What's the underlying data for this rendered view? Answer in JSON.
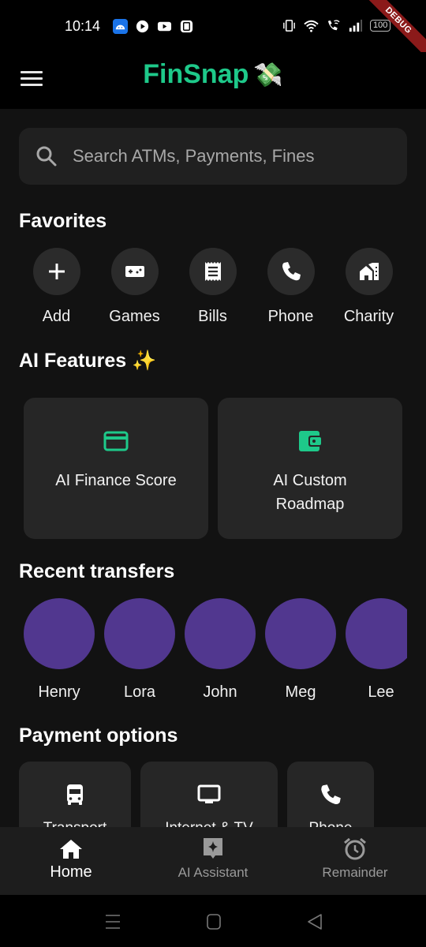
{
  "status_bar": {
    "time": "10:14",
    "left_icons": [
      "android-icon",
      "play-icon",
      "youtube-icon",
      "screenshot-icon"
    ],
    "right_icons": [
      "vibrate-icon",
      "wifi-icon",
      "wifi-calling-icon",
      "signal-icon"
    ],
    "battery": "100",
    "debug_label": "DEBUG"
  },
  "app_bar": {
    "title": "FinSnap",
    "title_emoji": "💸",
    "brand_color": "#1ec98a"
  },
  "search": {
    "placeholder": "Search ATMs, Payments, Fines"
  },
  "favorites": {
    "title": "Favorites",
    "items": [
      {
        "label": "Add",
        "icon": "plus-icon"
      },
      {
        "label": "Games",
        "icon": "gamepad-icon"
      },
      {
        "label": "Bills",
        "icon": "receipt-icon"
      },
      {
        "label": "Phone",
        "icon": "phone-icon"
      },
      {
        "label": "Charity",
        "icon": "house-icon"
      }
    ]
  },
  "ai_features": {
    "title": "AI Features ✨",
    "cards": [
      {
        "label": "AI Finance Score",
        "icon": "credit-card-icon"
      },
      {
        "label": "AI Custom Roadmap",
        "icon": "wallet-icon"
      }
    ]
  },
  "recent_transfers": {
    "title": "Recent transfers",
    "avatar_color": "#51378f",
    "people": [
      "Henry",
      "Lora",
      "John",
      "Meg",
      "Lee"
    ]
  },
  "payment_options": {
    "title": "Payment options",
    "items": [
      {
        "label": "Transport",
        "icon": "bus-icon"
      },
      {
        "label": "Internet & TV",
        "icon": "tv-icon"
      },
      {
        "label": "Phone",
        "icon": "phone-icon"
      }
    ]
  },
  "bottom_nav": {
    "items": [
      {
        "label": "Home",
        "icon": "home-icon",
        "active": true
      },
      {
        "label": "AI Assistant",
        "icon": "ai-assistant-icon",
        "active": false
      },
      {
        "label": "Remainder",
        "icon": "alarm-icon",
        "active": false
      }
    ]
  }
}
